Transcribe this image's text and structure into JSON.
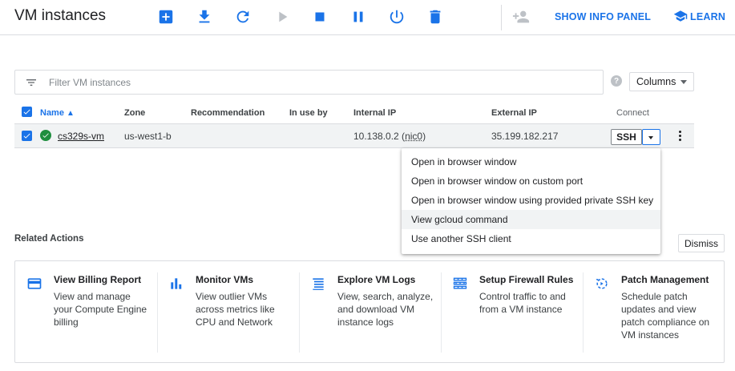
{
  "header": {
    "title": "VM instances",
    "show_info_panel": "SHOW INFO PANEL",
    "learn": "LEARN",
    "accent_color": "#1a73e8"
  },
  "filter": {
    "placeholder": "Filter VM instances",
    "columns_label": "Columns"
  },
  "table": {
    "headers": {
      "name": "Name",
      "zone": "Zone",
      "recommendation": "Recommendation",
      "in_use_by": "In use by",
      "internal_ip": "Internal IP",
      "external_ip": "External IP",
      "connect": "Connect"
    },
    "rows": [
      {
        "name": "cs329s-vm",
        "status": "running",
        "zone": "us-west1-b",
        "recommendation": "",
        "in_use_by": "",
        "internal_ip": "10.138.0.2",
        "internal_nic": "nic0",
        "external_ip": "35.199.182.217",
        "connect_label": "SSH"
      }
    ]
  },
  "ssh_menu": {
    "items": [
      "Open in browser window",
      "Open in browser window on custom port",
      "Open in browser window using provided private SSH key",
      "View gcloud command",
      "Use another SSH client"
    ]
  },
  "related": {
    "title": "Related Actions",
    "dismiss_label": "Dismiss",
    "cards": [
      {
        "icon": "credit-card-icon",
        "title": "View Billing Report",
        "desc": [
          "View and manage",
          "your Compute Engine",
          "billing"
        ]
      },
      {
        "icon": "bar-chart-icon",
        "title": "Monitor VMs",
        "desc": [
          "View outlier VMs",
          "across metrics like",
          "CPU and Network"
        ]
      },
      {
        "icon": "logs-icon",
        "title": "Explore VM Logs",
        "desc": [
          "View, search, analyze,",
          "and download VM",
          "instance logs"
        ]
      },
      {
        "icon": "firewall-icon",
        "title": "Setup Firewall Rules",
        "desc": [
          "Control traffic to and",
          "from a VM instance"
        ]
      },
      {
        "icon": "patch-icon",
        "title": "Patch Management",
        "desc": [
          "Schedule patch",
          "updates and view",
          "patch compliance on",
          "VM instances"
        ]
      }
    ]
  }
}
